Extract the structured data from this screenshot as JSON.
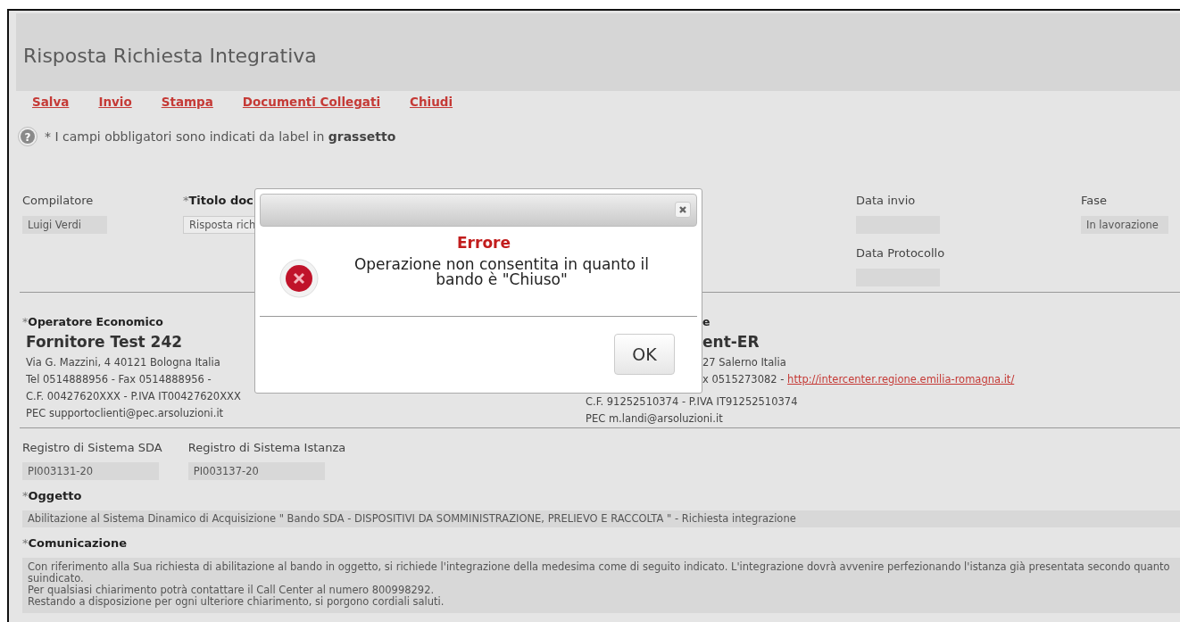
{
  "page": {
    "title": "Risposta Richiesta Integrativa",
    "help_icon": "?",
    "actions": [
      "Salva",
      "Invio",
      "Stampa",
      "Documenti Collegati",
      "Chiudi"
    ],
    "hint": "* I campi obbligatori sono indicati da label in **grassetto**"
  },
  "header_columns": [
    {
      "fields": [
        {
          "label": "Compilatore",
          "required": false,
          "value": "Luigi Verdi"
        }
      ]
    },
    {
      "fields": [
        {
          "mark": "*",
          "label": "Titolo doc",
          "required": true,
          "value": "Risposta rich"
        }
      ]
    },
    {
      "fields": [
        {
          "label": "Data invio",
          "required": false
        },
        {
          "label": "Data Protocollo",
          "required": false
        }
      ]
    },
    {
      "fields": [
        {
          "label": "Fase",
          "required": false,
          "value": "In lavorazione"
        }
      ]
    }
  ],
  "parties": [
    {
      "mark": "*",
      "label": "Operatore Economico",
      "name": "Fornitore Test 242",
      "lines": [
        {
          "text": "Via G. Mazzini, 4 40121 Bologna Italia"
        },
        {
          "text": "Tel 0514888956 - Fax 0514888956 -"
        },
        {
          "text": "C.F. 00427620XXX - P.IVA IT00427620XXX"
        },
        {
          "text": "PEC supportoclienti@pec.arsoluzioni.it"
        }
      ]
    },
    {
      "label": "e",
      "name": "ent-ER",
      "lines": [
        {
          "text": "27 Salerno Italia"
        },
        {
          "text": "x 0515273082 - ",
          "link": "http://intercenter.regione.emilia-romagna.it/"
        },
        {
          "text": "C.F. 91252510374 - P.IVA IT91252510374"
        },
        {
          "text": "PEC m.landi@arsoluzioni.it"
        }
      ]
    }
  ],
  "registers": [
    {
      "label": "Registro di Sistema SDA",
      "value": "PI003131-20"
    },
    {
      "label": "Registro di Sistema Istanza",
      "value": "PI003137-20"
    }
  ],
  "oggetto": {
    "mark": "*",
    "label": "Oggetto",
    "value": "Abilitazione al Sistema Dinamico di Acquisizione \" Bando SDA - DISPOSITIVI DA SOMMINISTRAZIONE, PRELIEVO E RACCOLTA \" - Richiesta integrazione"
  },
  "comunicazione": {
    "mark": "*",
    "label": "Comunicazione",
    "value": "Con riferimento alla Sua richiesta di abilitazione al bando in oggetto, si richiede l'integrazione della medesima come di seguito indicato. L'integrazione dovrà avvenire perfezionando l'istanza già presentata secondo quanto suindicato.\nPer qualsiasi chiarimento potrà contattare il Call Center al numero 800998292.\nRestando a disposizione per ogni ulteriore chiarimento, si porgono cordiali saluti."
  },
  "dialog": {
    "heading": "Errore",
    "message": "Operazione non consentita in quanto il\nbando è \"Chiuso\"",
    "button": "OK"
  }
}
